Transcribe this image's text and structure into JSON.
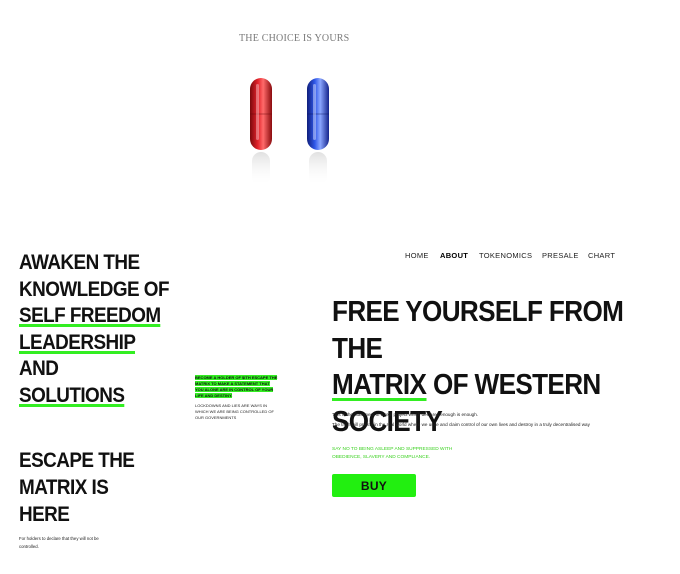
{
  "hero": {
    "tagline": "THE CHOICE IS YOURS"
  },
  "left": {
    "headline_line1": "AWAKEN THE",
    "headline_line2": "KNOWLEDGE OF",
    "headline_hl1": "SELF FREEDOM",
    "headline_hl2": "LEADERSHIP",
    "headline_and": " AND",
    "headline_hl3": "SOLUTIONS",
    "note_green": "BECOME A HOLDER OF $ITH ESCAPE THE MATRIX TO MAKE A STATEMENT THAT YOU ALONE ARE IN CONTROL OF YOUR LIFE AND DESTINY.",
    "note_gray": "LOCKDOWNS AND LIES ARE WAYS IN WHICH WE ARE BEING CONTROLLED OF OUR GOVERNMENTS",
    "escape_heading": "ESCAPE THE MATRIX IS HERE",
    "escape_small": "For holders to declare that they will not be controlled."
  },
  "nav": {
    "items": [
      "HOME",
      "ABOUT",
      "TOKENOMICS",
      "PRESALE",
      "CHART"
    ],
    "active": "ABOUT"
  },
  "right": {
    "headline_pre": "FREE YOURSELF FROM THE",
    "headline_hl": "MATRIX",
    "headline_mid": " OF WESTERN",
    "headline_post": "SOCIETY",
    "para1": "This is the statement of a real project which declares enough is enough.",
    "para2": "The truth will prevail in the real world where we unite and claim control of our own lives and destroy in a truly decentralised way",
    "green_text": "SAY NO TO BEING ASLEEP AND SUPPRESSED WITH OBEDIENCE, SLAVERY AND COMPLIANCE.",
    "buy_label": "BUY"
  },
  "colors": {
    "accent": "#22ef10",
    "red_pill": "#d0141a",
    "blue_pill": "#1f3fd6"
  },
  "icons": [
    "red-pill-icon",
    "blue-pill-icon"
  ]
}
